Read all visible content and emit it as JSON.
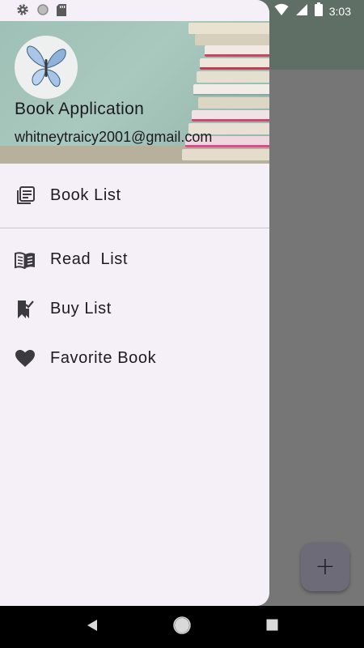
{
  "status_bar": {
    "time": "3:03",
    "left_icons": [
      "settings-icon",
      "circle-icon",
      "sd-card-icon"
    ],
    "right_icons": [
      "wifi-icon",
      "signal-icon",
      "battery-icon"
    ]
  },
  "drawer": {
    "header": {
      "app_title": "Book Application",
      "email": "whitneytraicy2001@gmail.com"
    },
    "primary_items": [
      {
        "label": "Book List",
        "icon": "book-list-icon"
      }
    ],
    "secondary_items": [
      {
        "label": "Read  List",
        "icon": "open-book-icon"
      },
      {
        "label": "Buy List",
        "icon": "bookmark-check-icon"
      },
      {
        "label": "Favorite Book",
        "icon": "heart-icon"
      }
    ]
  },
  "fab": {
    "label": "+"
  },
  "nav_bar": {
    "icons": [
      "back-icon",
      "home-icon",
      "recents-icon"
    ]
  },
  "colors": {
    "drawer_bg": "#f5eff8",
    "scrim": "#767676",
    "text": "#1d1b20"
  }
}
